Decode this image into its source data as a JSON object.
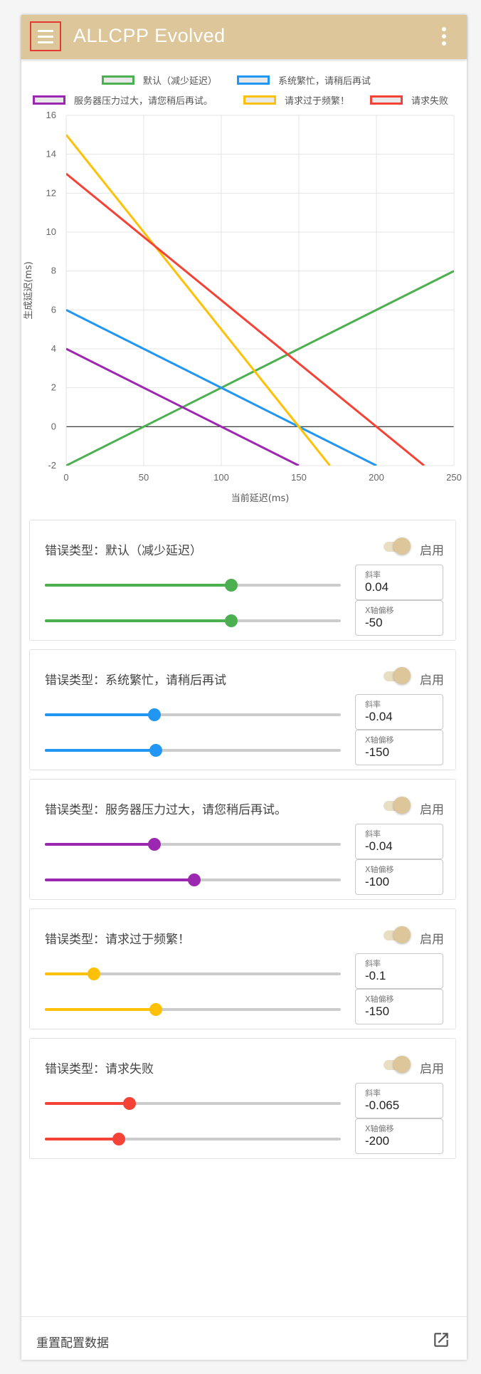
{
  "app": {
    "title": "ALLCPP Evolved"
  },
  "chart_data": {
    "type": "line",
    "xlabel": "当前延迟(ms)",
    "ylabel": "生成延迟(ms)",
    "xlim": [
      0,
      250
    ],
    "ylim": [
      -2,
      16
    ],
    "x_ticks": [
      0,
      50,
      100,
      150,
      200,
      250
    ],
    "y_ticks": [
      -2,
      0,
      2,
      4,
      6,
      8,
      10,
      12,
      14,
      16
    ],
    "grid": true,
    "legend": "top",
    "series": [
      {
        "name": "默认（减少延迟）",
        "color": "#4caf50",
        "slope": 0.04,
        "offset": -50,
        "points": [
          [
            0,
            -2
          ],
          [
            250,
            8
          ]
        ]
      },
      {
        "name": "系统繁忙，请稍后再试",
        "color": "#2196f3",
        "slope": -0.04,
        "offset": -150,
        "points": [
          [
            0,
            6
          ],
          [
            200,
            -2
          ]
        ]
      },
      {
        "name": "服务器压力过大，请您稍后再试。",
        "color": "#9c27b0",
        "slope": -0.04,
        "offset": -100,
        "points": [
          [
            0,
            4
          ],
          [
            150,
            -2
          ]
        ]
      },
      {
        "name": "请求过于频繁！",
        "color": "#ffc107",
        "slope": -0.1,
        "offset": -150,
        "points": [
          [
            0,
            15
          ],
          [
            170,
            -2
          ]
        ]
      },
      {
        "name": "请求失败",
        "color": "#f44336",
        "slope": -0.065,
        "offset": -200,
        "points": [
          [
            0,
            13
          ],
          [
            230.77,
            -2
          ]
        ]
      }
    ]
  },
  "cards": [
    {
      "title": "错误类型：默认（减少延迟）",
      "enabled_label": "启用",
      "enabled": true,
      "color": "#4caf50",
      "slope_label": "斜率",
      "slope_value": "0.04",
      "offset_label": "X轴偏移",
      "offset_value": "-50",
      "slope_slider": 0.63,
      "offset_slider": 0.63
    },
    {
      "title": "错误类型：系统繁忙，请稍后再试",
      "enabled_label": "启用",
      "enabled": true,
      "color": "#2196f3",
      "slope_label": "斜率",
      "slope_value": "-0.04",
      "offset_label": "X轴偏移",
      "offset_value": "-150",
      "slope_slider": 0.37,
      "offset_slider": 0.375
    },
    {
      "title": "错误类型：服务器压力过大，请您稍后再试。",
      "enabled_label": "启用",
      "enabled": true,
      "color": "#9c27b0",
      "slope_label": "斜率",
      "slope_value": "-0.04",
      "offset_label": "X轴偏移",
      "offset_value": "-100",
      "slope_slider": 0.37,
      "offset_slider": 0.505
    },
    {
      "title": "错误类型：请求过于频繁！",
      "enabled_label": "启用",
      "enabled": true,
      "color": "#ffc107",
      "slope_label": "斜率",
      "slope_value": "-0.1",
      "offset_label": "X轴偏移",
      "offset_value": "-150",
      "slope_slider": 0.165,
      "offset_slider": 0.375
    },
    {
      "title": "错误类型：请求失败",
      "enabled_label": "启用",
      "enabled": true,
      "color": "#f44336",
      "slope_label": "斜率",
      "slope_value": "-0.065",
      "offset_label": "X轴偏移",
      "offset_value": "-200",
      "slope_slider": 0.285,
      "offset_slider": 0.25
    }
  ],
  "footer": {
    "reset_label": "重置配置数据"
  }
}
